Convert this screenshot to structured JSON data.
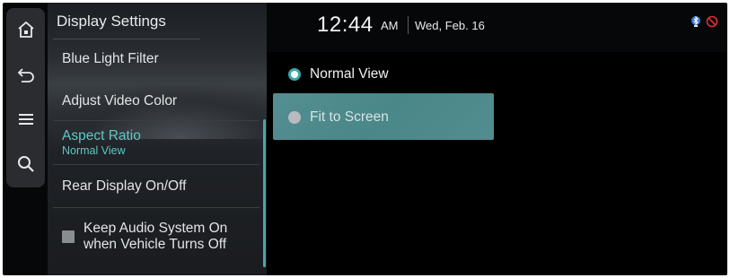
{
  "left_rail": {
    "buttons": [
      {
        "icon": "home-icon"
      },
      {
        "icon": "back-icon"
      },
      {
        "icon": "menu-icon"
      },
      {
        "icon": "search-icon"
      }
    ]
  },
  "panel": {
    "title": "Display Settings",
    "items": [
      {
        "label": "Blue Light Filter"
      },
      {
        "label": "Adjust Video Color"
      },
      {
        "label": "Aspect Ratio",
        "value": "Normal View"
      },
      {
        "label": "Rear Display On/Off"
      }
    ],
    "checkbox": {
      "label_line1": "Keep Audio System On",
      "label_line2": "when Vehicle Turns Off",
      "checked": false
    }
  },
  "header": {
    "time": "12:44",
    "ampm": "AM",
    "date": "Wed, Feb. 16",
    "status_icons": [
      "bluetooth-phone-icon",
      "no-connection-icon"
    ]
  },
  "options": {
    "items": [
      {
        "label": "Normal View",
        "selected": true
      },
      {
        "label": "Fit to Screen",
        "selected": false
      }
    ]
  },
  "colors": {
    "accent": "#5fc7c4",
    "highlight": "#4f8f90"
  }
}
